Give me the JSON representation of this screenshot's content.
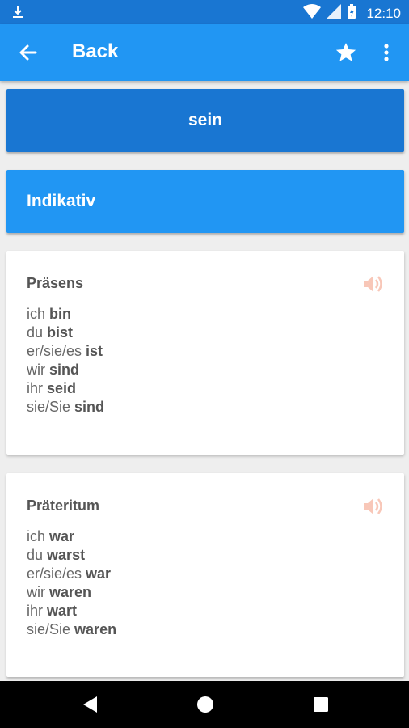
{
  "status_bar": {
    "time": "12:10",
    "icons": [
      "download-icon",
      "wifi-icon",
      "signal-icon",
      "battery-icon"
    ]
  },
  "app_bar": {
    "title": "Back",
    "icons": [
      "back-arrow-icon",
      "star-icon",
      "more-vert-icon"
    ]
  },
  "verb": "sein",
  "mood": "Indikativ",
  "colors": {
    "primary": "#2196f3",
    "primary_dark": "#1976d2",
    "speaker": "#f8c7b8"
  },
  "cards": [
    {
      "tense": "Präsens",
      "rows": [
        {
          "pronoun": "ich",
          "form": "bin"
        },
        {
          "pronoun": "du",
          "form": "bist"
        },
        {
          "pronoun": "er/sie/es",
          "form": "ist"
        },
        {
          "pronoun": "wir",
          "form": "sind"
        },
        {
          "pronoun": "ihr",
          "form": "seid"
        },
        {
          "pronoun": "sie/Sie",
          "form": "sind"
        }
      ]
    },
    {
      "tense": "Präteritum",
      "rows": [
        {
          "pronoun": "ich",
          "form": "war"
        },
        {
          "pronoun": "du",
          "form": "warst"
        },
        {
          "pronoun": "er/sie/es",
          "form": "war"
        },
        {
          "pronoun": "wir",
          "form": "waren"
        },
        {
          "pronoun": "ihr",
          "form": "wart"
        },
        {
          "pronoun": "sie/Sie",
          "form": "waren"
        }
      ]
    }
  ],
  "nav_bar": [
    "back-icon",
    "home-icon",
    "recents-icon"
  ]
}
